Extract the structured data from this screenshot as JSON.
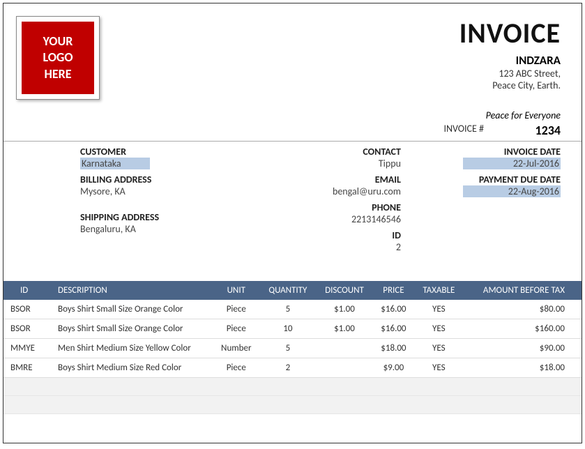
{
  "logo": {
    "line1": "YOUR",
    "line2": "LOGO",
    "line3": "HERE"
  },
  "title": "INVOICE",
  "company": {
    "name": "INDZARA",
    "addr1": "123 ABC Street,",
    "addr2": "Peace City, Earth."
  },
  "tagline": "Peace for Everyone",
  "invoice_num_label": "INVOICE #",
  "invoice_num": "1234",
  "customer": {
    "label": "CUSTOMER",
    "value": "Karnataka",
    "billing_label": "BILLING ADDRESS",
    "billing_value": "Mysore, KA",
    "shipping_label": "SHIPPING ADDRESS",
    "shipping_value": "Bengaluru, KA"
  },
  "contact": {
    "label": "CONTACT",
    "value": "Tippu",
    "email_label": "EMAIL",
    "email_value": "bengal@uru.com",
    "phone_label": "PHONE",
    "phone_value": "2213146546",
    "id_label": "ID",
    "id_value": "2"
  },
  "dates": {
    "invoice_date_label": "INVOICE DATE",
    "invoice_date": "22-Jul-2016",
    "due_label": "PAYMENT DUE DATE",
    "due_date": "22-Aug-2016"
  },
  "columns": {
    "id": "ID",
    "desc": "DESCRIPTION",
    "unit": "UNIT",
    "qty": "QUANTITY",
    "discount": "DISCOUNT",
    "price": "PRICE",
    "taxable": "TAXABLE",
    "amount": "AMOUNT BEFORE TAX"
  },
  "rows": [
    {
      "id": "BSOR",
      "desc": "Boys Shirt Small Size Orange Color",
      "unit": "Piece",
      "qty": "5",
      "discount": "$1.00",
      "price": "$16.00",
      "taxable": "YES",
      "amount": "$80.00"
    },
    {
      "id": "BSOR",
      "desc": "Boys Shirt Small Size Orange Color",
      "unit": "Piece",
      "qty": "10",
      "discount": "$1.00",
      "price": "$16.00",
      "taxable": "YES",
      "amount": "$160.00"
    },
    {
      "id": "MMYE",
      "desc": "Men Shirt Medium Size Yellow Color",
      "unit": "Number",
      "qty": "5",
      "discount": "",
      "price": "$18.00",
      "taxable": "YES",
      "amount": "$90.00"
    },
    {
      "id": "BMRE",
      "desc": "Boys Shirt Medium Size Red Color",
      "unit": "Piece",
      "qty": "2",
      "discount": "",
      "price": "$9.00",
      "taxable": "YES",
      "amount": "$18.00"
    }
  ]
}
